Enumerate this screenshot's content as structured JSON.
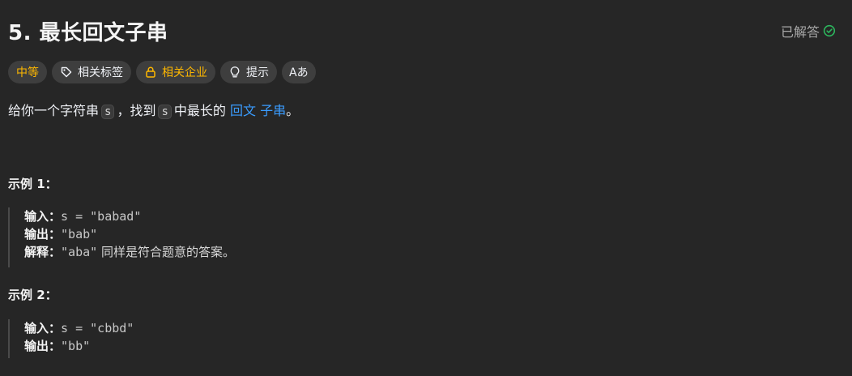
{
  "header": {
    "title": "5. 最长回文子串",
    "status": "已解答",
    "status_color": "#2db55d"
  },
  "tags": [
    {
      "label": "中等",
      "icon": ""
    },
    {
      "label": "相关标签",
      "icon": "tag-icon"
    },
    {
      "label": "相关企业",
      "icon": "lock-icon"
    },
    {
      "label": "提示",
      "icon": "lightbulb-icon"
    },
    {
      "label": "Aあ",
      "icon": "translate-icon"
    }
  ],
  "description": {
    "p1": "给你一个字符串",
    "code1": "s",
    "p2": "，找到",
    "code2": "s",
    "p3": "中最长的",
    "link1": "回文",
    "link2": "子串",
    "p4": "。"
  },
  "examples": [
    {
      "title": "示例 1：",
      "input_label": "输入：",
      "input_value": "s = \"babad\"",
      "output_label": "输出：",
      "output_value": "\"bab\"",
      "explain_label": "解释：",
      "explain_value": "\"aba\"",
      "explain_text": "同样是符合题意的答案。"
    },
    {
      "title": "示例 2：",
      "input_label": "输入：",
      "input_value": "s = \"cbbd\"",
      "output_label": "输出：",
      "output_value": "\"bb\""
    }
  ]
}
